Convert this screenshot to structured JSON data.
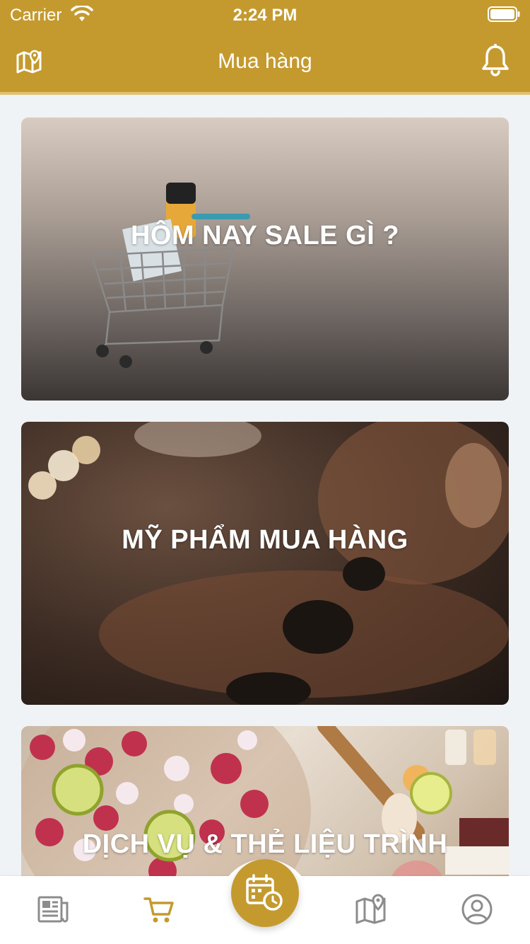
{
  "status_bar": {
    "carrier": "Carrier",
    "time": "2:24 PM"
  },
  "header": {
    "title": "Mua hàng"
  },
  "cards": [
    {
      "title": "HÔM NAY SALE GÌ ?"
    },
    {
      "title": "MỸ PHẨM MUA HÀNG"
    },
    {
      "title": "DỊCH VỤ & THẺ LIỆU TRÌNH"
    }
  ],
  "tabbar": {
    "items": [
      {
        "icon": "newspaper-icon"
      },
      {
        "icon": "cart-icon"
      },
      {
        "icon": "calendar-clock-icon"
      },
      {
        "icon": "map-pin-icon"
      },
      {
        "icon": "profile-icon"
      }
    ],
    "active_index": 1
  },
  "colors": {
    "accent": "#c49a2f",
    "inactive_icon": "#8c8c8c",
    "background": "#eff3f6"
  }
}
